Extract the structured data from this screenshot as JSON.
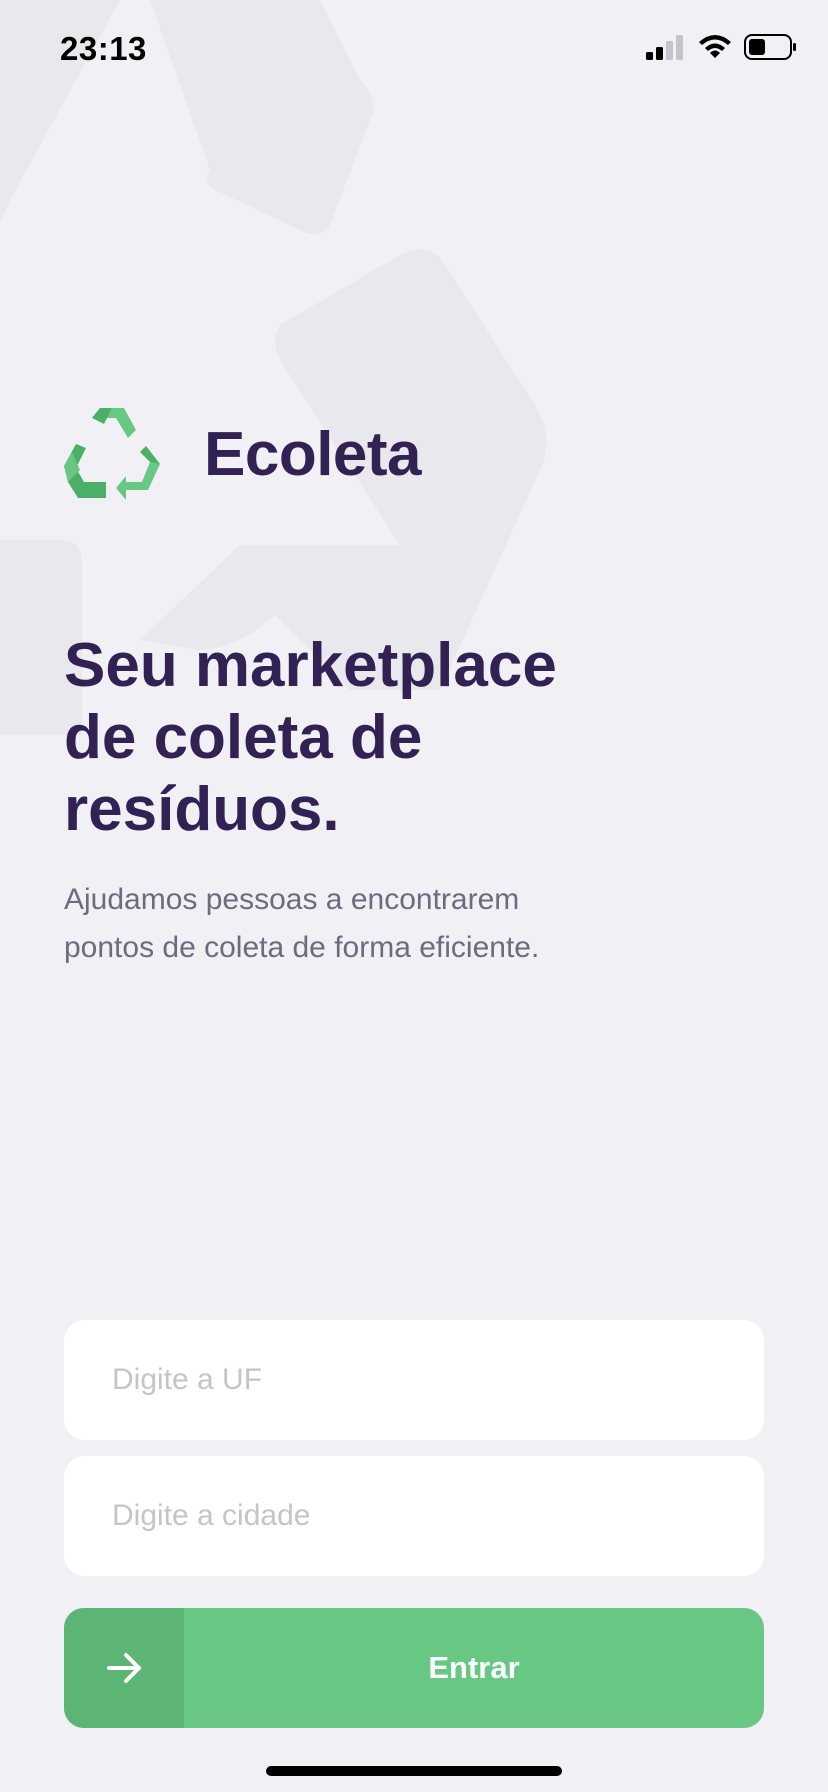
{
  "status_bar": {
    "time": "23:13",
    "icons": [
      "cellular-signal-icon",
      "wifi-icon",
      "battery-icon"
    ]
  },
  "brand": {
    "name": "Ecoleta",
    "logo_icon": "recycle-icon"
  },
  "hero": {
    "title_lines": [
      "Seu marketplace",
      "de coleta de",
      "resíduos."
    ],
    "description_lines": [
      "Ajudamos pessoas a encontrarem",
      "pontos de coleta de forma eficiente."
    ]
  },
  "form": {
    "uf": {
      "placeholder": "Digite a UF",
      "value": ""
    },
    "city": {
      "placeholder": "Digite a cidade",
      "value": ""
    },
    "submit": {
      "label": "Entrar",
      "icon": "arrow-right-icon"
    }
  },
  "colors": {
    "background": "#F0F0F5",
    "title": "#322153",
    "text": "#6C6C80",
    "primary": "#68C883",
    "primary_dark": "#5CB575",
    "placeholder": "#C4C4CC"
  }
}
